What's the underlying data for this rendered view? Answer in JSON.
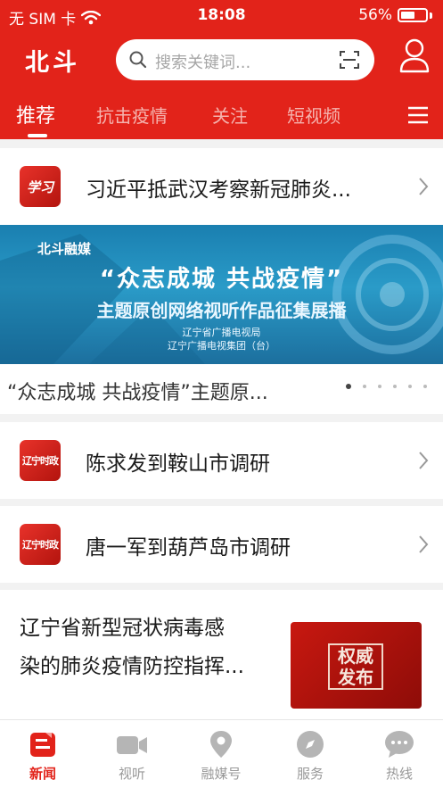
{
  "status_bar": {
    "carrier": "无 SIM 卡",
    "time": "18:08",
    "battery": "56%",
    "battery_level": 0.56
  },
  "header": {
    "logo": "北斗",
    "search_placeholder": "搜索关键词..."
  },
  "tabs": [
    {
      "label": "推荐",
      "active": true
    },
    {
      "label": "抗击疫情",
      "active": false
    },
    {
      "label": "关注",
      "active": false
    },
    {
      "label": "短视频",
      "active": false
    }
  ],
  "feed": {
    "item1": {
      "logo_text": "学习",
      "title": "习近平抵武汉考察新冠肺炎..."
    },
    "banner": {
      "brand": "北斗融媒",
      "headline": "“众志成城  共战疫情”",
      "subheadline": "主题原创网络视听作品征集展播",
      "org1": "辽宁省广播电视局",
      "org2": "辽宁广播电视集团（台）",
      "caption": "“众志成城 共战疫情”主题原...",
      "dots_count": 6,
      "active_dot": 0
    },
    "item2": {
      "logo_text": "辽宁时政",
      "title": "陈求发到鞍山市调研"
    },
    "item3": {
      "logo_text": "辽宁时政",
      "title": "唐一军到葫芦岛市调研"
    },
    "item4": {
      "title_line1": "辽宁省新型冠状病毒感",
      "title_line2": "染的肺炎疫情防控指挥...",
      "thumb_line1": "权威",
      "thumb_line2": "发布"
    }
  },
  "tabbar": [
    {
      "label": "新闻",
      "icon": "news-icon",
      "active": true
    },
    {
      "label": "视听",
      "icon": "video-camera-icon",
      "active": false
    },
    {
      "label": "融媒号",
      "icon": "location-pin-icon",
      "active": false
    },
    {
      "label": "服务",
      "icon": "compass-icon",
      "active": false
    },
    {
      "label": "热线",
      "icon": "chat-bubble-icon",
      "active": false
    }
  ],
  "colors": {
    "brand_red": "#e2231a",
    "inactive_gray": "#999999"
  }
}
